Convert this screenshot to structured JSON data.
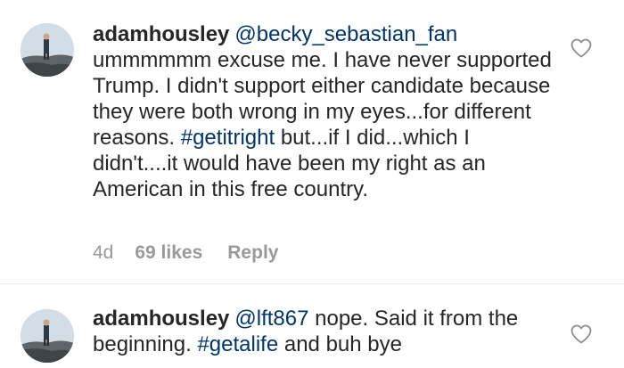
{
  "comments": [
    {
      "username": "adamhousley",
      "mention": "@becky_sebastian_fan",
      "text_1": "ummmmmm excuse me. I have never supported Trump. I didn't support either candidate because they were both wrong in my eyes...for different reasons.",
      "hashtag": "#getitright",
      "text_2": "but...if I did...which I didn't....it would have been my right as an American in this free country.",
      "time": "4d",
      "likes": "69 likes",
      "reply_label": "Reply"
    },
    {
      "username": "adamhousley",
      "mention": "@lft867",
      "text_1": "nope. Said it from the beginning.",
      "hashtag": "#getalife",
      "text_2": "and buh bye"
    }
  ],
  "icons": {
    "like": "heart-outline-icon",
    "avatar": "profile-photo"
  },
  "colors": {
    "text": "#262626",
    "link": "#003569",
    "meta": "#999999"
  }
}
